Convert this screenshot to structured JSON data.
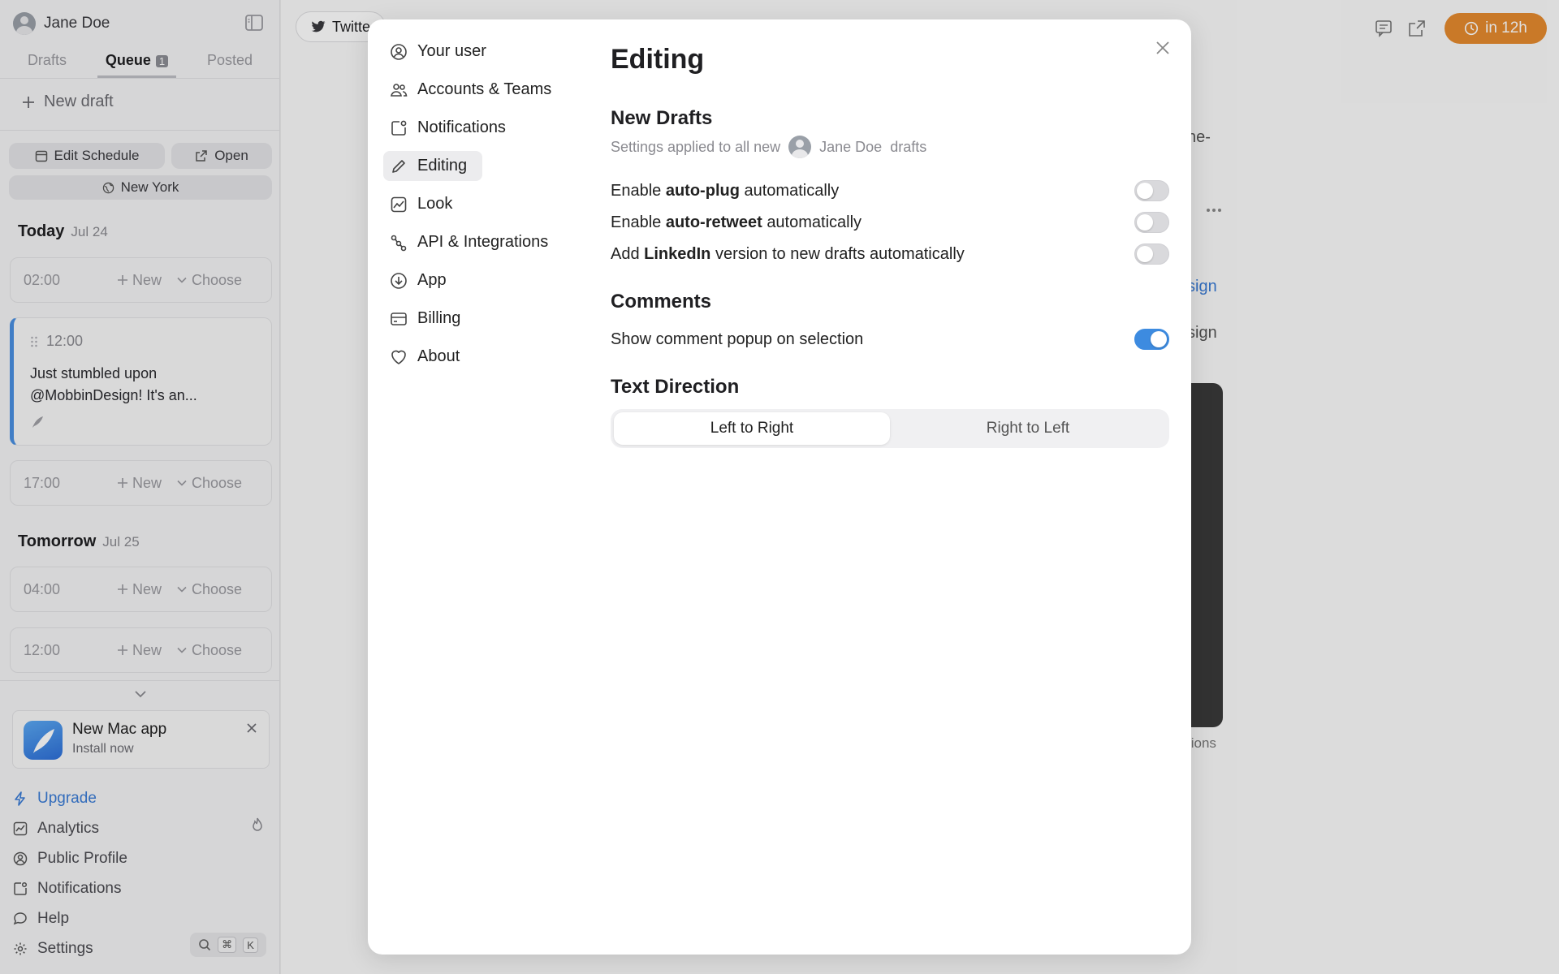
{
  "user": {
    "name": "Jane Doe"
  },
  "tabs": {
    "drafts": "Drafts",
    "queue": "Queue",
    "queue_count": "1",
    "posted": "Posted"
  },
  "new_draft": "New draft",
  "schedule": {
    "edit": "Edit Schedule",
    "open": "Open",
    "timezone": "New York"
  },
  "today": {
    "label": "Today",
    "date": "Jul 24"
  },
  "tomorrow": {
    "label": "Tomorrow",
    "date": "Jul 25"
  },
  "slot_actions": {
    "new": "New",
    "choose": "Choose"
  },
  "slots_today": [
    "02:00",
    "17:00"
  ],
  "slots_tomorrow": [
    "04:00",
    "12:00"
  ],
  "post": {
    "time": "12:00",
    "text": "Just stumbled upon @MobbinDesign! It's an..."
  },
  "mac_app": {
    "title": "New Mac app",
    "subtitle": "Install now"
  },
  "bottom_nav": {
    "upgrade": "Upgrade",
    "analytics": "Analytics",
    "public_profile": "Public Profile",
    "notifications": "Notifications",
    "help": "Help",
    "settings": "Settings",
    "shortcut_cmd": "⌘",
    "shortcut_key": "K"
  },
  "topbar": {
    "twitter": "Twitte",
    "timer": "in 12h"
  },
  "background_text": {
    "a": "ne-",
    "b": "sign",
    "c": "sign",
    "d": "tions"
  },
  "modal": {
    "nav": [
      "Your user",
      "Accounts & Teams",
      "Notifications",
      "Editing",
      "Look",
      "API & Integrations",
      "App",
      "Billing",
      "About"
    ],
    "title": "Editing",
    "new_drafts": {
      "heading": "New Drafts",
      "subtitle_prefix": "Settings applied to all new",
      "subtitle_user": "Jane Doe",
      "subtitle_suffix": "drafts",
      "autoplug": {
        "pre": "Enable",
        "bold": "auto-plug",
        "post": "automatically",
        "enabled": false
      },
      "autoretweet": {
        "pre": "Enable",
        "bold": "auto-retweet",
        "post": "automatically",
        "enabled": false
      },
      "linkedin": {
        "pre": "Add",
        "bold": "LinkedIn",
        "post": "version to new drafts automatically",
        "enabled": false
      }
    },
    "comments": {
      "heading": "Comments",
      "popup_label": "Show comment popup on selection",
      "enabled": true
    },
    "text_direction": {
      "heading": "Text Direction",
      "ltr": "Left to Right",
      "rtl": "Right to Left",
      "selected": "Left to Right"
    }
  },
  "colors": {
    "accent": "#3d8be0",
    "timer": "#e58a2e",
    "post_border": "#4a90e2"
  }
}
